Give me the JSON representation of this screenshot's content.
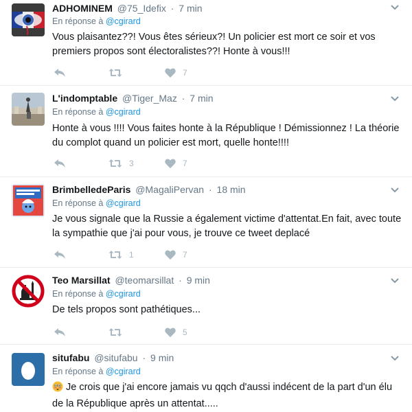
{
  "reply_prefix": "En réponse à",
  "tweets": [
    {
      "name": "ADHOMINEM",
      "handle": "@75_Idefix",
      "time": "7 min",
      "reply_to": "@cgirard",
      "text": "Vous plaisantez??! Vous êtes sérieux?! Un  policier est mort ce soir et vos premiers propos sont électoralistes??! Honte à vous!!!",
      "retweets": "",
      "likes": "7",
      "avatar_icon": "eye-flag-avatar"
    },
    {
      "name": "L'indomptable",
      "handle": "@Tiger_Maz",
      "time": "7 min",
      "reply_to": "@cgirard",
      "text": "Honte à vous !!!! Vous faites honte à la République ! Démissionnez ! La théorie du complot quand un policier est mort, quelle honte!!!!",
      "retweets": "3",
      "likes": "7",
      "avatar_icon": "statue-square-avatar"
    },
    {
      "name": "BrimbelledeParis",
      "handle": "@MagaliPervan",
      "time": "18 min",
      "reply_to": "@cgirard",
      "text": "Je vous signale que la Russie a également victime d'attentat.En fait, avec toute la sympathie que j'ai pour vous, je trouve ce tweet deplacé",
      "retweets": "1",
      "likes": "7",
      "avatar_icon": "smurf-poster-avatar"
    },
    {
      "name": "Teo Marsillat",
      "handle": "@teomarsillat",
      "time": "9 min",
      "reply_to": "@cgirard",
      "text": "De tels propos sont pathétiques...",
      "retweets": "",
      "likes": "5",
      "avatar_icon": "prohibited-mosque-avatar"
    },
    {
      "name": "situfabu",
      "handle": "@situfabu",
      "time": "9 min",
      "reply_to": "@cgirard",
      "emoji": "flushed-face-emoji",
      "text": "Je crois que j'ai encore jamais vu qqch d'aussi indécent de la part d'un élu de la République après un attentat.....",
      "retweets": "",
      "likes": "",
      "avatar_icon": "default-egg-avatar"
    }
  ]
}
